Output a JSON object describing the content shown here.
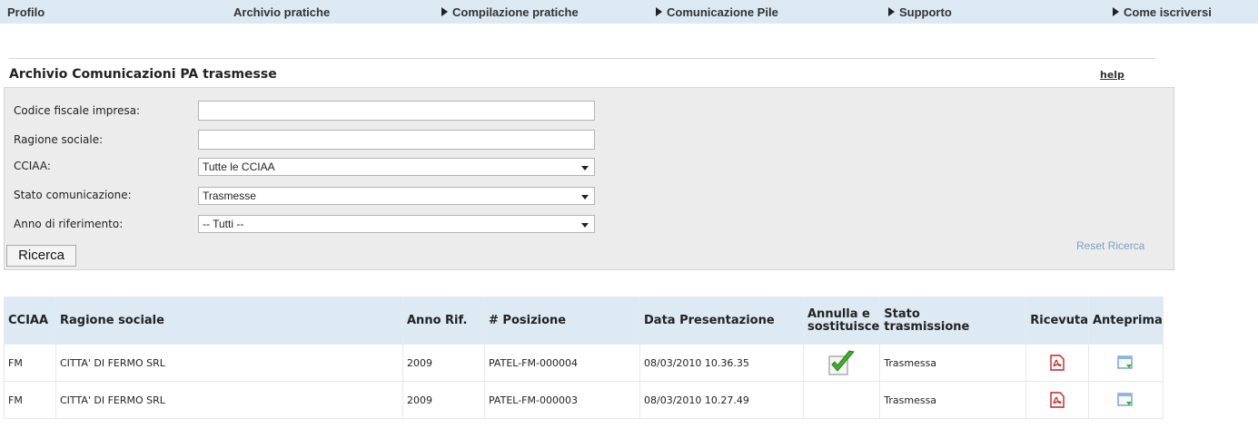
{
  "nav": {
    "items": [
      {
        "label": "Profilo",
        "arrow": false
      },
      {
        "label": "Archivio pratiche",
        "arrow": false
      },
      {
        "label": "Compilazione pratiche",
        "arrow": true
      },
      {
        "label": "Comunicazione Pile",
        "arrow": true
      },
      {
        "label": "Supporto",
        "arrow": true
      },
      {
        "label": "Come iscriversi",
        "arrow": true
      }
    ]
  },
  "section": {
    "title": "Archivio Comunicazioni PA trasmesse",
    "help": "help"
  },
  "search": {
    "codice_fiscale_label": "Codice fiscale impresa:",
    "codice_fiscale_value": "",
    "ragione_sociale_label": "Ragione sociale:",
    "ragione_sociale_value": "",
    "cciaa_label": "CCIAA:",
    "cciaa_selected": "Tutte le CCIAA",
    "stato_label": "Stato comunicazione:",
    "stato_selected": "Trasmesse",
    "anno_label": "Anno di riferimento:",
    "anno_selected": "-- Tutti --",
    "button": "Ricerca",
    "reset": "Reset Ricerca"
  },
  "table": {
    "headers": {
      "cciaa": "CCIAA",
      "ragione_sociale": "Ragione sociale",
      "anno": "Anno Rif.",
      "posizione": "# Posizione",
      "data": "Data Presentazione",
      "annulla_1": "Annulla e",
      "annulla_2": "sostituisce",
      "stato_1": "Stato",
      "stato_2": "trasmissione",
      "ricevuta": "Ricevuta",
      "anteprima": "Anteprima"
    },
    "rows": [
      {
        "cciaa": "FM",
        "ragione_sociale": "CITTA' DI FERMO SRL",
        "anno": "2009",
        "posizione": "PATEL-FM-000004",
        "data": "08/03/2010 10.36.35",
        "annulla": true,
        "stato": "Trasmessa"
      },
      {
        "cciaa": "FM",
        "ragione_sociale": "CITTA' DI FERMO SRL",
        "anno": "2009",
        "posizione": "PATEL-FM-000003",
        "data": "08/03/2010 10.27.49",
        "annulla": false,
        "stato": "Trasmessa"
      }
    ]
  },
  "icons": {
    "nav_arrow": "triangle-right-icon",
    "check": "checkmark-icon",
    "ricevuta": "pdf-icon",
    "anteprima": "preview-window-icon"
  },
  "colors": {
    "nav_bg": "#dce9f3",
    "panel_bg": "#ececec",
    "header_bg": "#dde9f3",
    "link_reset": "#7a9ec7",
    "pdf_red": "#cc1f1f",
    "check_green": "#3fae2a"
  }
}
